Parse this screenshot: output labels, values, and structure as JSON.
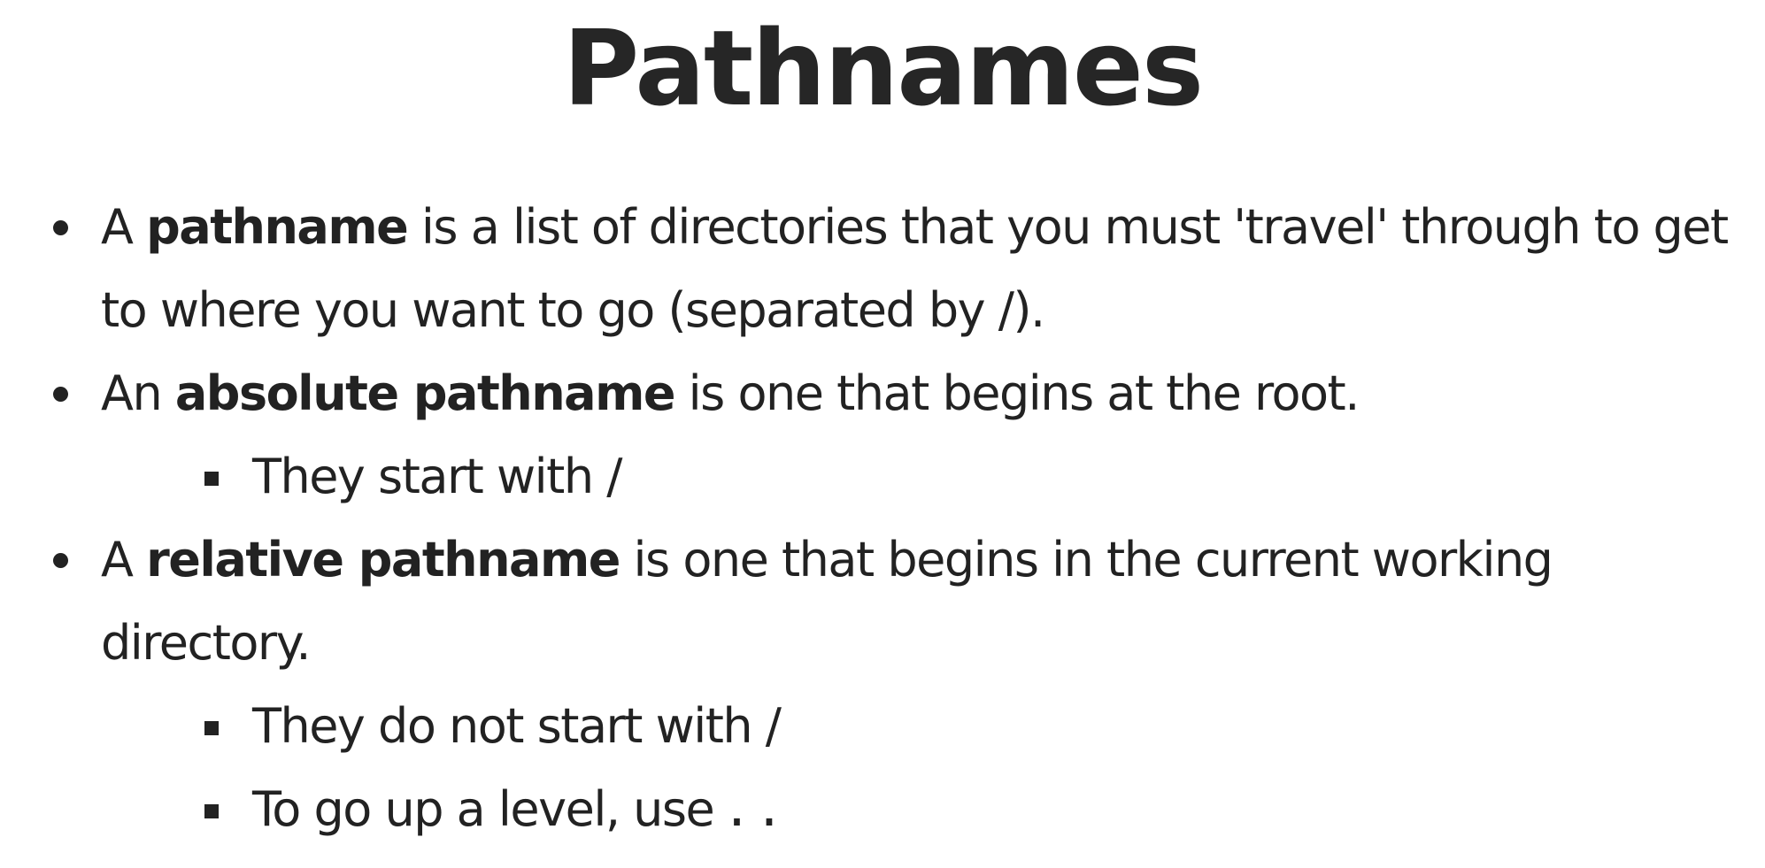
{
  "title": "Pathnames",
  "bullets": [
    {
      "pre": "A ",
      "bold": "pathname",
      "post": " is a list of directories that you must 'travel' through to get to where you want to go (separated by /)."
    },
    {
      "pre": "An ",
      "bold": "absolute pathname",
      "post": " is one that begins at the root.",
      "sub": [
        "They start with /"
      ]
    },
    {
      "pre": "A ",
      "bold": "relative pathname",
      "post": " is one that begins in the current working directory.",
      "sub": [
        "They do not start with /"
      ],
      "sub_code_item": {
        "text": "To go up a level, use",
        "code": ".."
      }
    }
  ]
}
